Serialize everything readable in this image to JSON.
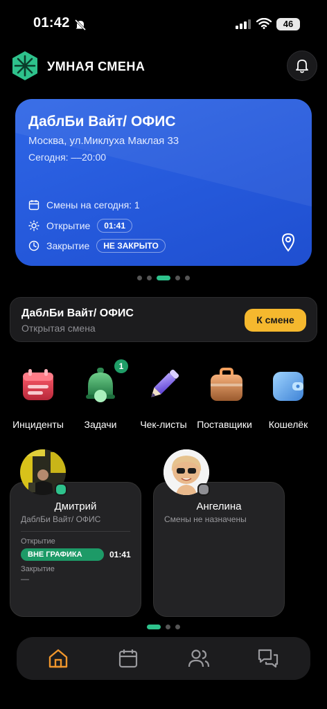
{
  "status_bar": {
    "time": "01:42",
    "battery": "46"
  },
  "app": {
    "title": "УМНАЯ СМЕНА"
  },
  "location_card": {
    "title": "ДаблБи Вайт/ ОФИС",
    "address": "Москва, ул.Миклуха Маклая 33",
    "today": "Сегодня: ––20:00",
    "shifts_today": "Смены на сегодня: 1",
    "opening_label": "Открытие",
    "opening_time": "01:41",
    "closing_label": "Закрытие",
    "closing_status": "НЕ ЗАКРЫТО"
  },
  "carousel": {
    "dot_count": 5,
    "active_index": 2
  },
  "open_shift": {
    "title": "ДаблБи Вайт/ ОФИС",
    "subtitle": "Открытая смена",
    "button": "К смене"
  },
  "quick_actions": [
    {
      "label": "Инциденты",
      "icon": "calendar-incident-icon"
    },
    {
      "label": "Задачи",
      "icon": "bell-task-icon",
      "badge": "1"
    },
    {
      "label": "Чек-листы",
      "icon": "pencil-icon"
    },
    {
      "label": "Поставщики",
      "icon": "bag-icon"
    },
    {
      "label": "Кошелёк",
      "icon": "wallet-icon"
    }
  ],
  "employees": [
    {
      "name": "Дмитрий",
      "place": "ДаблБи Вайт/ ОФИС",
      "opening_label": "Открытие",
      "status_pill": "ВНЕ ГРАФИКА",
      "opening_time": "01:41",
      "closing_label": "Закрытие",
      "closing_value": "—",
      "online": true
    },
    {
      "name": "Ангелина",
      "place": "Смены не назначены",
      "online": false
    }
  ],
  "employee_dots": {
    "dot_count": 3,
    "active_index": 0
  },
  "bottom_nav": [
    "home-icon",
    "calendar-icon",
    "users-icon",
    "chat-icon"
  ],
  "colors": {
    "accent_green": "#2ec28c",
    "card_blue": "#2559db",
    "button_yellow": "#f5b82e",
    "nav_active": "#f0962c"
  }
}
